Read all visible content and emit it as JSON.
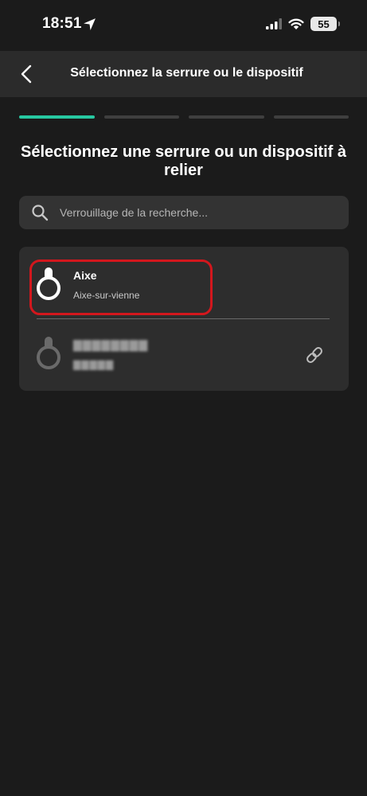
{
  "status_bar": {
    "time": "18:51",
    "battery": "55"
  },
  "header": {
    "title": "Sélectionnez la serrure ou le dispositif"
  },
  "progress": {
    "total_steps": 4,
    "current_step": 1,
    "active_color": "#27c8a1"
  },
  "page": {
    "heading": "Sélectionnez une serrure ou un dispositif à relier"
  },
  "search": {
    "placeholder": "Verrouillage de la recherche...",
    "value": ""
  },
  "locks": [
    {
      "name": "Aixe",
      "location": "Aixe-sur-vienne",
      "icon": "lock-icon",
      "highlighted": true
    },
    {
      "name": "▇▇▇▇▇▇▇▇",
      "location": "▇▇▇▇▇",
      "icon": "lock-icon",
      "action_icon": "link-icon",
      "pixelated": true
    }
  ],
  "colors": {
    "background": "#1b1b1b",
    "header": "#2b2b2b",
    "card": "#2d2d2d",
    "highlight": "#d3171d"
  }
}
